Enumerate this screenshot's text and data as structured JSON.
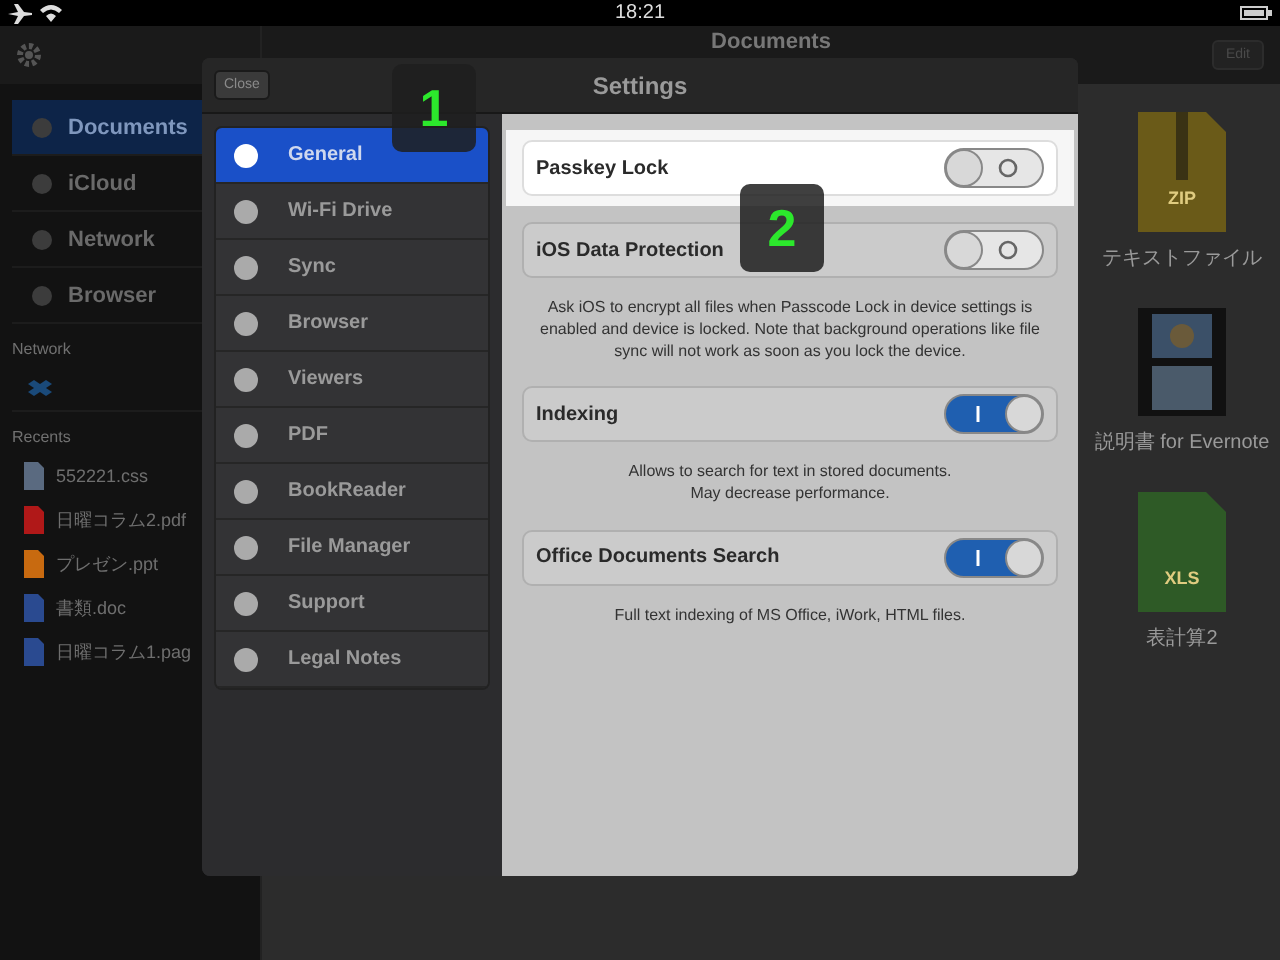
{
  "status_bar": {
    "time": "18:21"
  },
  "app": {
    "title": "Documents",
    "edit_button": "Edit",
    "sidebar": {
      "items": [
        {
          "label": "Documents",
          "selected": true
        },
        {
          "label": "iCloud",
          "selected": false
        },
        {
          "label": "Network",
          "selected": false
        },
        {
          "label": "Browser",
          "selected": false
        }
      ],
      "network_header": "Network",
      "recents_header": "Recents",
      "recents": [
        {
          "name": "552221.css",
          "color": "#5a6a80"
        },
        {
          "name": "日曜コラム2.pdf",
          "color": "#b01818"
        },
        {
          "name": "プレゼン.ppt",
          "color": "#c86a10"
        },
        {
          "name": "書類.doc",
          "color": "#2a4a90"
        },
        {
          "name": "日曜コラム1.pag",
          "color": "#2a4a90"
        }
      ]
    },
    "files": [
      {
        "name": "テキストファイル",
        "kind": "zip",
        "badge": "ZIP"
      },
      {
        "name": "説明書 for Evernote",
        "kind": "video"
      },
      {
        "name": "表計算2",
        "kind": "sheet",
        "badge": "XLS"
      }
    ]
  },
  "settings": {
    "title": "Settings",
    "close_button": "Close",
    "menu": [
      {
        "label": "General",
        "selected": true
      },
      {
        "label": "Wi-Fi Drive",
        "selected": false
      },
      {
        "label": "Sync",
        "selected": false
      },
      {
        "label": "Browser",
        "selected": false
      },
      {
        "label": "Viewers",
        "selected": false
      },
      {
        "label": "PDF",
        "selected": false
      },
      {
        "label": "BookReader",
        "selected": false
      },
      {
        "label": "File Manager",
        "selected": false
      },
      {
        "label": "Support",
        "selected": false
      },
      {
        "label": "Legal Notes",
        "selected": false
      }
    ],
    "rows": [
      {
        "kind": "toggle",
        "label": "Passkey Lock",
        "on": false,
        "highlighted": true
      },
      {
        "kind": "toggle",
        "label": "iOS Data Protection",
        "on": false,
        "highlighted": false
      },
      {
        "kind": "note",
        "text": "Ask iOS to encrypt all files when Passcode Lock in device settings is enabled and device is locked. Note that background operations like file sync will not work as soon as you lock the device."
      },
      {
        "kind": "toggle",
        "label": "Indexing",
        "on": true,
        "highlighted": false
      },
      {
        "kind": "note",
        "text": "Allows to search for text in stored documents.\nMay decrease performance."
      },
      {
        "kind": "toggle",
        "label": "Office Documents Search",
        "on": true,
        "highlighted": false
      },
      {
        "kind": "note",
        "text": "Full text indexing of MS Office, iWork, HTML files."
      }
    ]
  },
  "callouts": [
    {
      "label": "1"
    },
    {
      "label": "2"
    }
  ]
}
